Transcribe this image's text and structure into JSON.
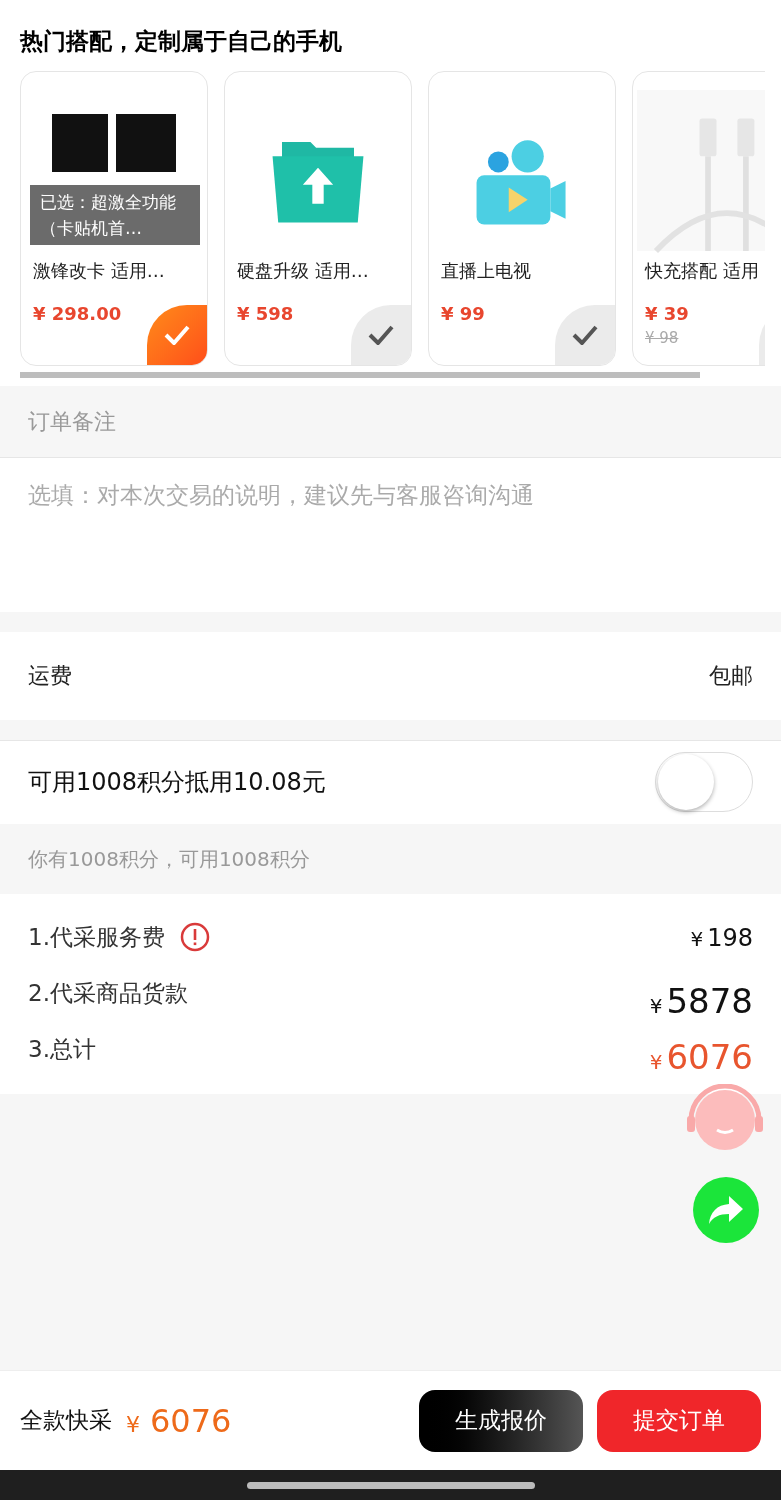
{
  "section_title": "热门搭配，定制属于自己的手机",
  "products": [
    {
      "kind": "logo",
      "title": "激锋改卡 适用…",
      "price": "¥ 298.00",
      "selected": true,
      "overlay": "已选：超激全功能（卡贴机首…"
    },
    {
      "kind": "folder",
      "title": "硬盘升级 适用…",
      "price": "¥ 598",
      "selected": false
    },
    {
      "kind": "camera",
      "title": "直播上电视",
      "price": "¥ 99",
      "selected": false
    },
    {
      "kind": "cable",
      "title": "快充搭配 适用",
      "price": "¥ 39",
      "old_price": "¥ 98",
      "selected": false
    }
  ],
  "remark": {
    "label": "订单备注",
    "placeholder": "选填：对本次交易的说明，建议先与客服咨询沟通"
  },
  "shipping": {
    "label": "运费",
    "value": "包邮"
  },
  "points": {
    "label": "可用1008积分抵用10.08元",
    "on": false,
    "hint": "你有1008积分，可用1008积分"
  },
  "fees": [
    {
      "kind": "info",
      "label": "1.代采服务费",
      "amount": "198"
    },
    {
      "kind": "large",
      "label": "2.代采商品货款",
      "amount": "5878"
    },
    {
      "kind": "total",
      "label": "3.总计",
      "amount": "6076"
    }
  ],
  "currency": "¥",
  "bottom": {
    "label": "全款快采",
    "total": "6076",
    "buttons": [
      "生成报价",
      "提交订单"
    ]
  }
}
